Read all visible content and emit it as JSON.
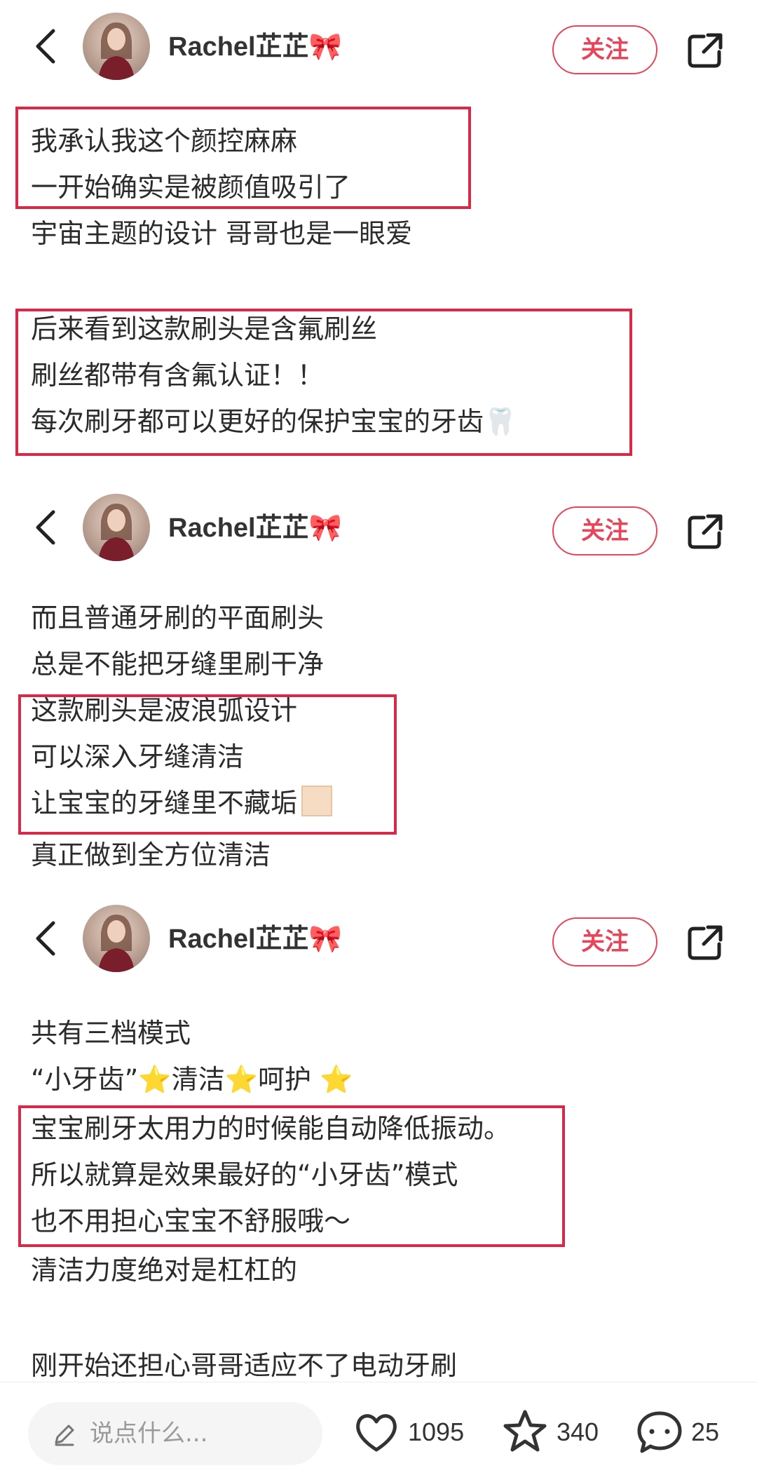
{
  "posts": [
    {
      "user": {
        "name": "Rachel芷芷🎀",
        "follow_label": "关注"
      },
      "lines": [
        "我承认我这个颜控麻麻",
        "一开始确实是被颜值吸引了",
        "宇宙主题的设计 哥哥也是一眼爱",
        "后来看到这款刷头是含氟刷丝",
        "刷丝都带有含氟认证！！",
        "每次刷牙都可以更好的保护宝宝的牙齿🦷"
      ]
    },
    {
      "user": {
        "name": "Rachel芷芷🎀",
        "follow_label": "关注"
      },
      "lines": [
        "而且普通牙刷的平面刷头",
        "总是不能把牙缝里刷干净",
        "这款刷头是波浪弧设计",
        "可以深入牙缝清洁",
        "让宝宝的牙缝里不藏垢",
        "真正做到全方位清洁"
      ]
    },
    {
      "user": {
        "name": "Rachel芷芷🎀",
        "follow_label": "关注"
      },
      "lines": [
        "共有三档模式",
        "“小牙齿”⭐清洁⭐呵护 ⭐",
        "宝宝刷牙太用力的时候能自动降低振动。",
        "所以就算是效果最好的“小牙齿”模式",
        "也不用担心宝宝不舒服哦～",
        "清洁力度绝对是杠杠的",
        "刚开始还担心哥哥适应不了电动牙刷"
      ]
    }
  ],
  "bottom_bar": {
    "comment_placeholder": "说点什么...",
    "likes": "1095",
    "favorites": "340",
    "comments": "25"
  },
  "colors": {
    "accent": "#e8445a",
    "highlight_box": "#d62a48"
  }
}
